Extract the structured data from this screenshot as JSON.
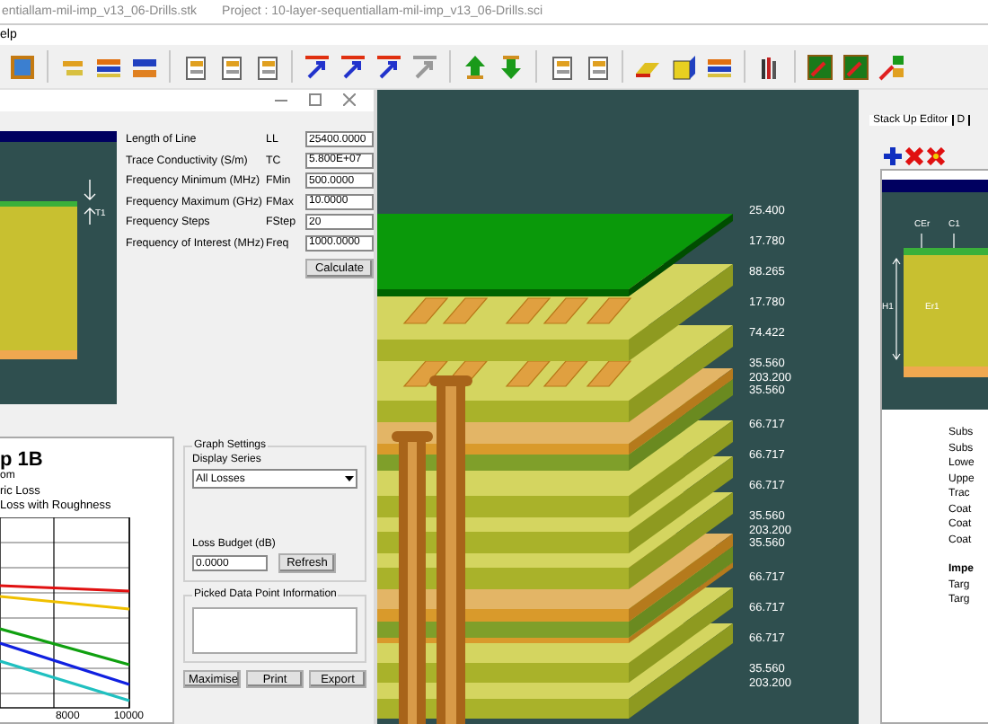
{
  "window": {
    "title": "entiallam-mil-imp_v13_06-Drills.stk",
    "project": "Project : 10-layer-sequentiallam-mil-imp_v13_06-Drills.sci"
  },
  "menu": [
    "elp"
  ],
  "calculator": {
    "diagram_labels": [
      "T1"
    ],
    "fields": [
      {
        "label": "Length of Line",
        "symbol": "LL",
        "value": "25400.0000"
      },
      {
        "label": "Trace Conductivity (S/m)",
        "symbol": "TC",
        "value": "5.800E+07"
      },
      {
        "label": "Frequency Minimum (MHz)",
        "symbol": "FMin",
        "value": "500.0000"
      },
      {
        "label": "Frequency Maximum (GHz)",
        "symbol": "FMax",
        "value": "10.0000"
      },
      {
        "label": "Frequency Steps",
        "symbol": "FStep",
        "value": "20"
      },
      {
        "label": "Frequency of Interest (MHz)",
        "symbol": "Freq",
        "value": "1000.0000"
      }
    ],
    "calculate_button": "Calculate",
    "graph": {
      "title": "p 1B",
      "subtitle": "om",
      "legend": [
        "ric Loss",
        "Loss with Roughness"
      ],
      "x_tick_labels": [
        "8000",
        "10000"
      ]
    },
    "graph_settings": {
      "title": "Graph Settings",
      "display_series_label": "Display Series",
      "display_series": "All Losses",
      "loss_budget_label": "Loss Budget (dB)",
      "loss_budget": "0.0000",
      "refresh_button": "Refresh"
    },
    "picked_point": {
      "title": "Picked Data Point Information"
    },
    "buttons": [
      "Maximise",
      "Print",
      "Export"
    ]
  },
  "stackup": {
    "thickness_labels": [
      [
        "25.400"
      ],
      [
        "17.780"
      ],
      [
        "88.265"
      ],
      [
        "17.780"
      ],
      [
        "74.422"
      ],
      [
        "35.560",
        "203.200",
        "35.560"
      ],
      [
        "66.717"
      ],
      [
        "66.717"
      ],
      [
        "66.717"
      ],
      [
        "35.560",
        "203.200",
        "35.560"
      ],
      [
        "66.717"
      ],
      [
        "66.717"
      ],
      [
        "66.717"
      ],
      [
        "35.560",
        "203.200"
      ]
    ]
  },
  "side_panel": {
    "tabs": [
      {
        "label": "Stack Up Editor",
        "selected": true
      },
      {
        "label": "D",
        "selected": false
      }
    ],
    "diagram_labels": [
      "CEr",
      "C1",
      "H1",
      "Er1"
    ],
    "fields": [
      "Subs",
      "Subs",
      "Lowe",
      "Uppe",
      "Trac",
      "Coat",
      "Coat",
      "Coat"
    ],
    "section_title": "Impe",
    "targets": [
      "Targ",
      "Targ"
    ]
  }
}
